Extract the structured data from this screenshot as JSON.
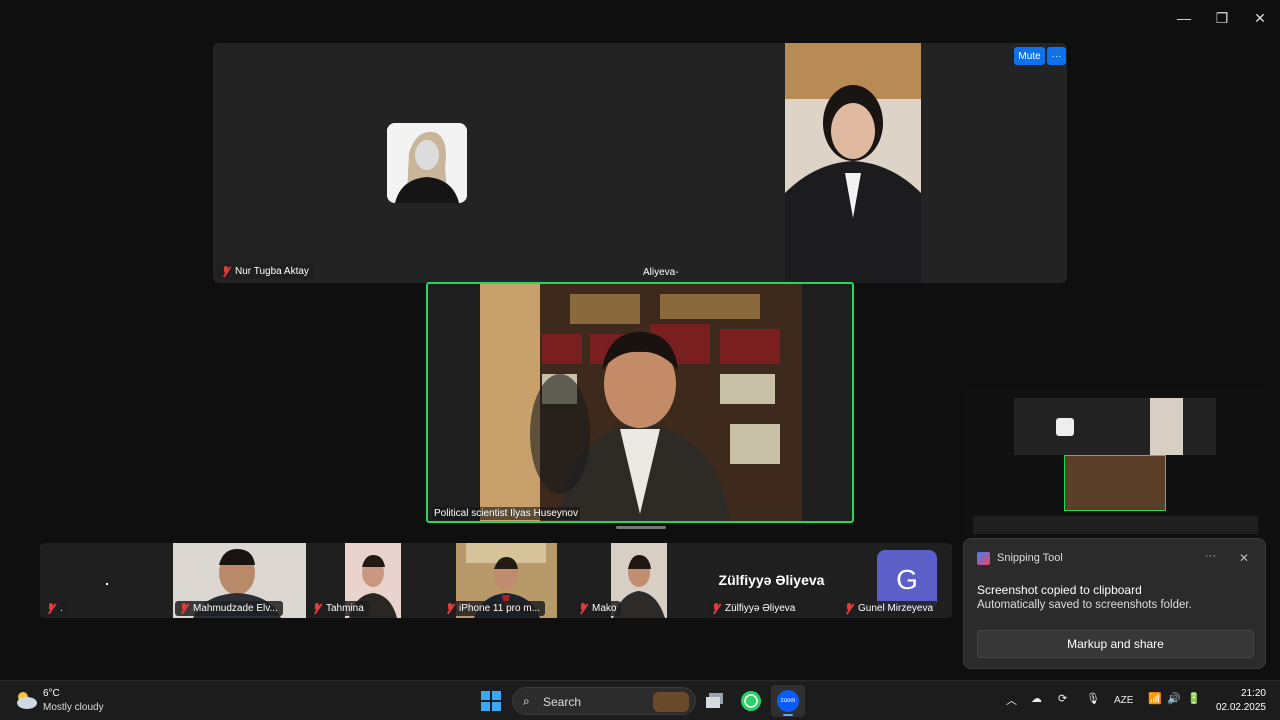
{
  "window": {
    "minimize": "—",
    "restore": "❐",
    "close": "✕"
  },
  "top_panel": {
    "left_name": "Nur Tugba Aktay",
    "right_name": "Aliyeva-",
    "mute_label": "Mute",
    "more_label": "···"
  },
  "speaker": {
    "name": "Political scientist Ilyas Huseynov"
  },
  "strip": {
    "tiles": [
      {
        "name": "."
      },
      {
        "name": "Mahmudzade Elv..."
      },
      {
        "name": "Tahmina"
      },
      {
        "name": "iPhone 11 pro m..."
      },
      {
        "name": "Mako"
      },
      {
        "name": "Zülfiyyə Əliyeva",
        "big_name": "Zülfiyyə Əliyeva"
      },
      {
        "name": "Gunel Mirzeyeva",
        "initial": "G"
      }
    ]
  },
  "toast": {
    "app_name": "Snipping Tool",
    "more": "···",
    "close": "✕",
    "title": "Screenshot copied to clipboard",
    "body": "Automatically saved to screenshots folder.",
    "action": "Markup and share"
  },
  "taskbar": {
    "weather_temp": "6°C",
    "weather_desc": "Mostly cloudy",
    "search_placeholder": "Search",
    "zoom_label": "zoom",
    "language": "AZE",
    "time": "21:20",
    "date": "02.02.2025"
  },
  "colors": {
    "active_border": "#23d959",
    "accent": "#0e72ed",
    "muted_red": "#e03a3a"
  }
}
